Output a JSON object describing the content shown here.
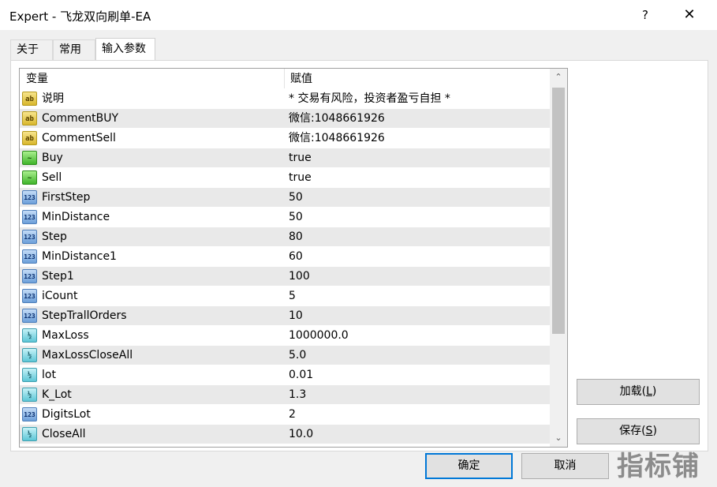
{
  "window": {
    "title": "Expert - 飞龙双向刷单-EA",
    "help_glyph": "?",
    "close_glyph": "✕"
  },
  "tabs": [
    {
      "label": "关于",
      "active": false
    },
    {
      "label": "常用",
      "active": false
    },
    {
      "label": "输入参数",
      "active": true
    }
  ],
  "grid": {
    "headers": {
      "variable": "变量",
      "value": "赋值"
    },
    "rows": [
      {
        "icon": "ab",
        "type": "string",
        "name": "说明",
        "value": "* 交易有风险，投资者盈亏自担 *"
      },
      {
        "icon": "ab",
        "type": "string",
        "name": "CommentBUY",
        "value": "微信:1048661926"
      },
      {
        "icon": "ab",
        "type": "string",
        "name": "CommentSell",
        "value": "微信:1048661926"
      },
      {
        "icon": "~",
        "type": "bool",
        "name": "Buy",
        "value": "true"
      },
      {
        "icon": "~",
        "type": "bool",
        "name": "Sell",
        "value": "true"
      },
      {
        "icon": "123",
        "type": "int",
        "name": "FirstStep",
        "value": "50"
      },
      {
        "icon": "123",
        "type": "int",
        "name": "MinDistance",
        "value": "50"
      },
      {
        "icon": "123",
        "type": "int",
        "name": "Step",
        "value": "80"
      },
      {
        "icon": "123",
        "type": "int",
        "name": "MinDistance1",
        "value": "60"
      },
      {
        "icon": "123",
        "type": "int",
        "name": "Step1",
        "value": "100"
      },
      {
        "icon": "123",
        "type": "int",
        "name": "iCount",
        "value": "5"
      },
      {
        "icon": "123",
        "type": "int",
        "name": "StepTrallOrders",
        "value": "10"
      },
      {
        "icon": "½",
        "type": "double",
        "name": "MaxLoss",
        "value": "1000000.0"
      },
      {
        "icon": "½",
        "type": "double",
        "name": "MaxLossCloseAll",
        "value": "5.0"
      },
      {
        "icon": "½",
        "type": "double",
        "name": "lot",
        "value": "0.01"
      },
      {
        "icon": "½",
        "type": "double",
        "name": "K_Lot",
        "value": "1.3"
      },
      {
        "icon": "123",
        "type": "int",
        "name": "DigitsLot",
        "value": "2"
      },
      {
        "icon": "½",
        "type": "double",
        "name": "CloseAll",
        "value": "10.0"
      }
    ],
    "scroll_up_glyph": "⌃",
    "scroll_down_glyph": "⌄"
  },
  "buttons": {
    "load": {
      "label": "加载(",
      "accel": "L",
      "end": ")"
    },
    "save": {
      "label": "保存(",
      "accel": "S",
      "end": ")"
    },
    "ok": "确定",
    "cancel": "取消"
  },
  "watermark": "指标铺"
}
